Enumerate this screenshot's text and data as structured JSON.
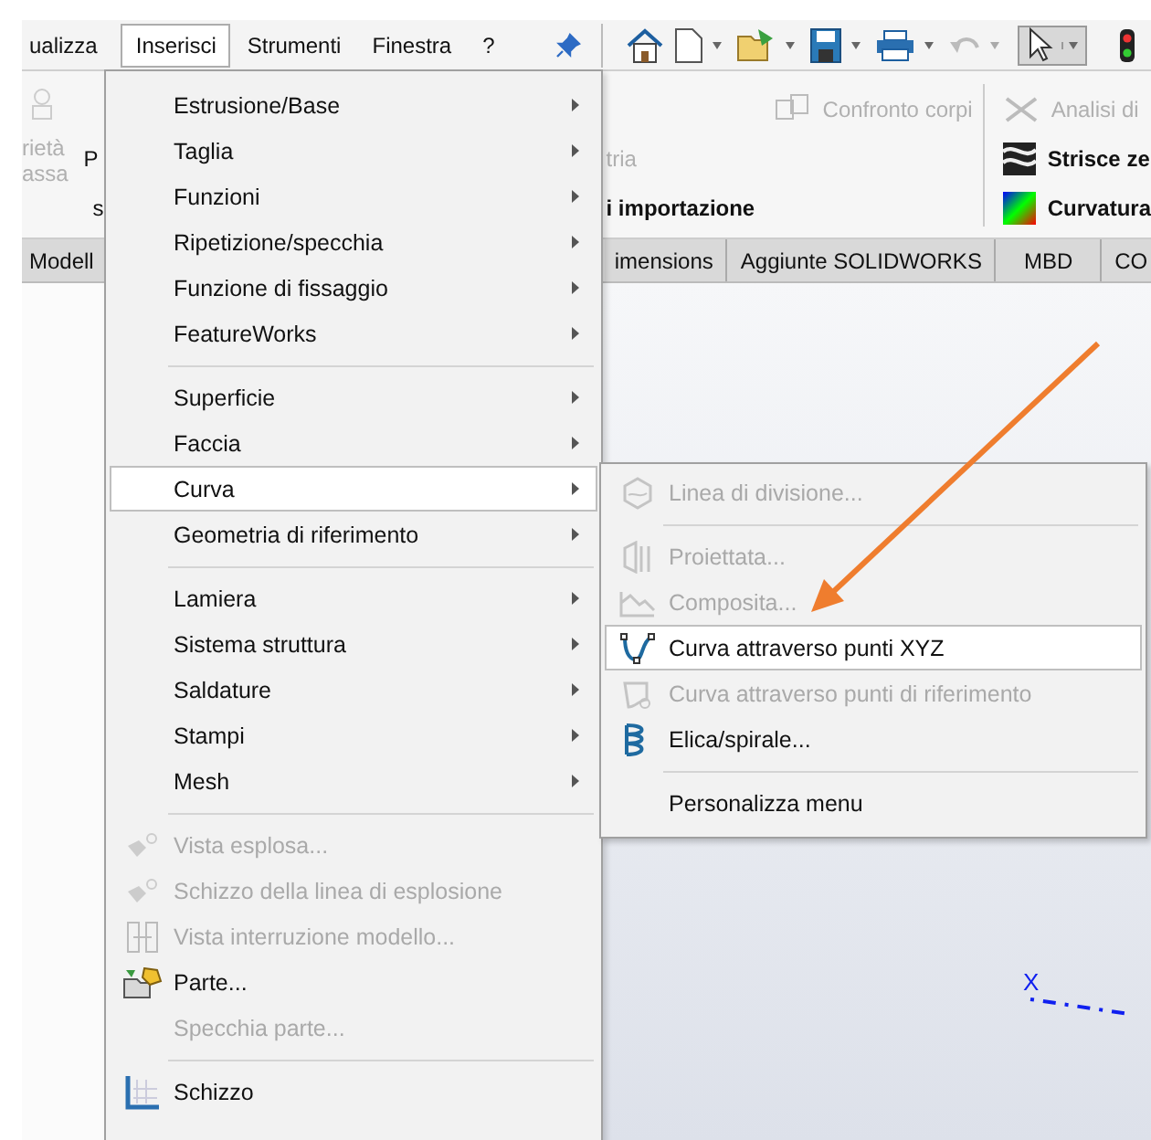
{
  "menu_bar": {
    "items": [
      {
        "label": "ualizza",
        "selected": false
      },
      {
        "label": "Inserisci",
        "selected": true
      },
      {
        "label": "Strumenti",
        "selected": false
      },
      {
        "label": "Finestra",
        "selected": false
      },
      {
        "label": "?",
        "selected": false
      }
    ]
  },
  "ribbon": {
    "groups": [
      {
        "items": [
          {
            "label": "rietà",
            "disabled": true
          },
          {
            "label": "assa",
            "disabled": true
          }
        ]
      },
      {
        "items": [
          {
            "label": "P",
            "disabled": false
          },
          {
            "label": "s",
            "disabled": false
          }
        ]
      },
      {
        "items": [
          {
            "label": "Confronto corpi",
            "disabled": true
          },
          {
            "label": "tria",
            "disabled": true
          },
          {
            "label": "i importazione",
            "disabled": false
          }
        ]
      },
      {
        "items": [
          {
            "label": "Analisi di",
            "disabled": true
          },
          {
            "label": "Strisce ze",
            "disabled": false
          },
          {
            "label": "Curvatura",
            "disabled": false
          }
        ]
      }
    ]
  },
  "tabs": [
    {
      "label": "Modell",
      "selected": false
    },
    {
      "label": "imensions",
      "selected": false
    },
    {
      "label": "Aggiunte SOLIDWORKS",
      "selected": false
    },
    {
      "label": "MBD",
      "selected": false
    },
    {
      "label": "CO",
      "selected": false
    }
  ],
  "menu": {
    "items": [
      {
        "kind": "item",
        "label": "Estrusione/Base",
        "submenu": true,
        "disabled": false,
        "selected": false
      },
      {
        "kind": "item",
        "label": "Taglia",
        "submenu": true,
        "disabled": false,
        "selected": false
      },
      {
        "kind": "item",
        "label": "Funzioni",
        "submenu": true,
        "disabled": false,
        "selected": false
      },
      {
        "kind": "item",
        "label": "Ripetizione/specchia",
        "submenu": true,
        "disabled": false,
        "selected": false
      },
      {
        "kind": "item",
        "label": "Funzione di fissaggio",
        "submenu": true,
        "disabled": false,
        "selected": false
      },
      {
        "kind": "item",
        "label": "FeatureWorks",
        "submenu": true,
        "disabled": false,
        "selected": false
      },
      {
        "kind": "separator"
      },
      {
        "kind": "item",
        "label": "Superficie",
        "submenu": true,
        "disabled": false,
        "selected": false
      },
      {
        "kind": "item",
        "label": "Faccia",
        "submenu": true,
        "disabled": false,
        "selected": false
      },
      {
        "kind": "item",
        "label": "Curva",
        "submenu": true,
        "disabled": false,
        "selected": true
      },
      {
        "kind": "item",
        "label": "Geometria di riferimento",
        "submenu": true,
        "disabled": false,
        "selected": false
      },
      {
        "kind": "separator"
      },
      {
        "kind": "item",
        "label": "Lamiera",
        "submenu": true,
        "disabled": false,
        "selected": false
      },
      {
        "kind": "item",
        "label": "Sistema struttura",
        "submenu": true,
        "disabled": false,
        "selected": false
      },
      {
        "kind": "item",
        "label": "Saldature",
        "submenu": true,
        "disabled": false,
        "selected": false
      },
      {
        "kind": "item",
        "label": "Stampi",
        "submenu": true,
        "disabled": false,
        "selected": false
      },
      {
        "kind": "item",
        "label": "Mesh",
        "submenu": true,
        "disabled": false,
        "selected": false
      },
      {
        "kind": "separator"
      },
      {
        "kind": "item",
        "label": "Vista esplosa...",
        "submenu": false,
        "disabled": true,
        "selected": false
      },
      {
        "kind": "item",
        "label": "Schizzo della linea di esplosione",
        "submenu": false,
        "disabled": true,
        "selected": false
      },
      {
        "kind": "item",
        "label": "Vista interruzione modello...",
        "submenu": false,
        "disabled": true,
        "selected": false
      },
      {
        "kind": "item",
        "label": "Parte...",
        "submenu": false,
        "disabled": false,
        "selected": false
      },
      {
        "kind": "item",
        "label": "Specchia parte...",
        "submenu": false,
        "disabled": true,
        "selected": false
      },
      {
        "kind": "separator"
      },
      {
        "kind": "item",
        "label": "Schizzo",
        "submenu": false,
        "disabled": false,
        "selected": false
      }
    ]
  },
  "submenu": {
    "items": [
      {
        "kind": "item",
        "label": "Linea di divisione...",
        "disabled": true,
        "selected": false
      },
      {
        "kind": "separator"
      },
      {
        "kind": "item",
        "label": "Proiettata...",
        "disabled": true,
        "selected": false
      },
      {
        "kind": "item",
        "label": "Composita...",
        "disabled": true,
        "selected": false
      },
      {
        "kind": "item",
        "label": "Curva attraverso punti XYZ",
        "disabled": false,
        "selected": true
      },
      {
        "kind": "item",
        "label": "Curva attraverso punti di riferimento",
        "disabled": true,
        "selected": false
      },
      {
        "kind": "item",
        "label": "Elica/spirale...",
        "disabled": false,
        "selected": false
      },
      {
        "kind": "separator"
      },
      {
        "kind": "item",
        "label": "Personalizza menu",
        "disabled": false,
        "selected": false
      }
    ]
  },
  "viewport": {
    "axis_label": "X"
  }
}
